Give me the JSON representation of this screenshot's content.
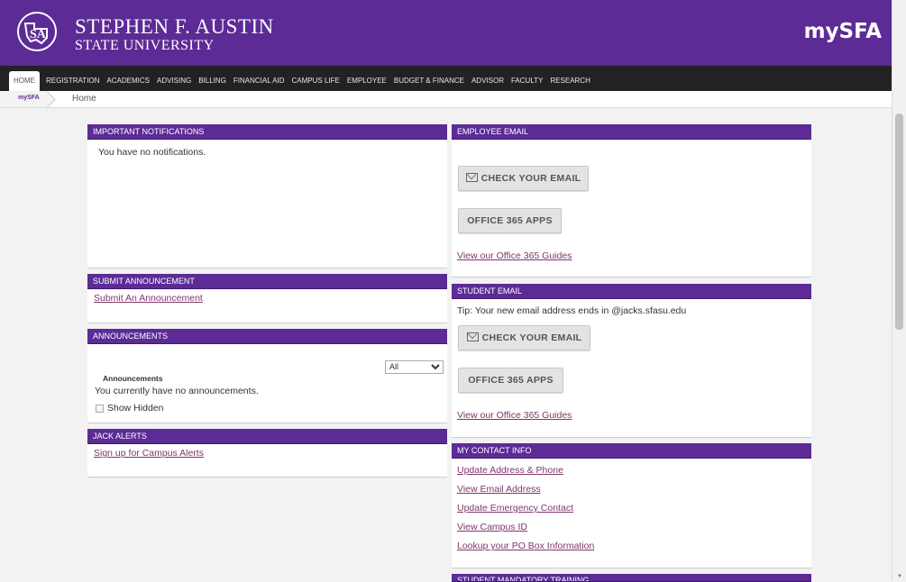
{
  "header": {
    "university_line1": "STEPHEN F. AUSTIN",
    "university_line2": "STATE UNIVERSITY",
    "brand": "mySFA",
    "brand_color": "#5c2b96"
  },
  "nav": {
    "items": [
      "HOME",
      "REGISTRATION",
      "ACADEMICS",
      "ADVISING",
      "BILLING",
      "FINANCIAL AID",
      "CAMPUS LIFE",
      "EMPLOYEE",
      "BUDGET & FINANCE",
      "ADVISOR",
      "FACULTY",
      "RESEARCH"
    ],
    "active": "HOME"
  },
  "breadcrumb": {
    "root": "mySFA",
    "current": "Home"
  },
  "left": {
    "notifications": {
      "title": "IMPORTANT NOTIFICATIONS",
      "text": "You have no notifications."
    },
    "submit_announcement": {
      "title": "SUBMIT ANNOUNCEMENT",
      "link": "Submit An Announcement"
    },
    "announcements": {
      "title": "ANNOUNCEMENTS",
      "filter_value": "All",
      "subtitle": "Announcements",
      "text": "You currently have no announcements.",
      "show_hidden": "Show Hidden"
    },
    "jack_alerts": {
      "title": "JACK ALERTS",
      "link": "Sign up for Campus Alerts"
    }
  },
  "right": {
    "employee_email": {
      "title": "EMPLOYEE EMAIL",
      "check_email": "CHECK YOUR EMAIL",
      "office_apps": "OFFICE 365 APPS",
      "guides_link": "View our Office 365 Guides"
    },
    "student_email": {
      "title": "STUDENT EMAIL",
      "tip": "Tip: Your new email address ends in @jacks.sfasu.edu",
      "check_email": "CHECK YOUR EMAIL",
      "office_apps": "OFFICE 365 APPS",
      "guides_link": "View our Office 365 Guides"
    },
    "contact_info": {
      "title": "MY CONTACT INFO",
      "links": [
        "Update Address & Phone",
        "View Email Address",
        "Update Emergency Contact",
        "View Campus ID",
        "Lookup your PO Box Information"
      ]
    },
    "mandatory_training": {
      "title": "STUDENT MANDATORY TRAINING"
    }
  }
}
